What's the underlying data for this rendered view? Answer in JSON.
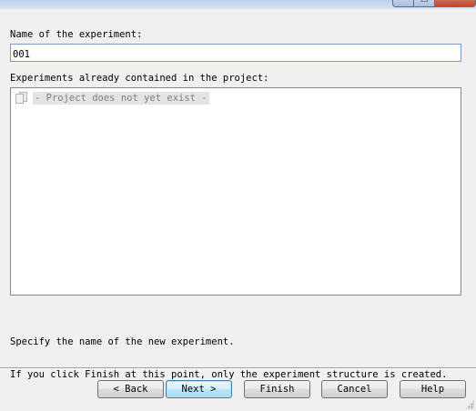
{
  "window_controls": {
    "minimize_glyph": "–",
    "maximize_glyph": "□",
    "close_glyph": "✕"
  },
  "form": {
    "name_label": "Name of the experiment:",
    "name_value": "001",
    "list_label": "Experiments already contained in the project:",
    "list_items": [
      {
        "text": "- Project does not yet exist -",
        "icon": "document-stack-icon"
      }
    ]
  },
  "info": {
    "line1": "Specify the name of the new experiment.",
    "line2": "If you click Finish at this point, only the experiment structure is created."
  },
  "buttons": {
    "back": "< Back",
    "next": "Next >",
    "finish": "Finish",
    "cancel": "Cancel",
    "help": "Help"
  },
  "colors": {
    "background": "#f0f0f0",
    "input_border_focus": "#7a9cc6",
    "default_button_border": "#3c7fb1",
    "close_button": "#c7432a"
  }
}
